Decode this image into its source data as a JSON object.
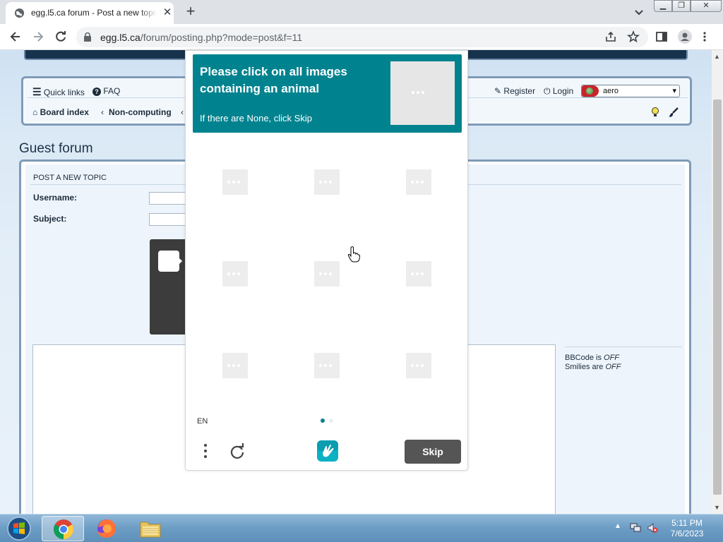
{
  "browser": {
    "tab_title": "egg.l5.ca forum - Post a new topic",
    "url_host": "egg.l5.ca",
    "url_path": "/forum/posting.php?mode=post&f=11"
  },
  "nav": {
    "quick_links": "Quick links",
    "faq": "FAQ",
    "register": "Register",
    "login": "Login",
    "board_index": "Board index",
    "crumb": "Non-computing",
    "style_value": "aero"
  },
  "page": {
    "forum_title": "Guest forum",
    "post_heading": "POST A NEW TOPIC",
    "username_label": "Username:",
    "subject_label": "Subject:",
    "bbcode_text": "BBCode is ",
    "bbcode_state": "OFF",
    "smilies_text": "Smilies are ",
    "smilies_state": "OFF"
  },
  "captcha": {
    "prompt": "Please click on all images containing an animal",
    "subprompt": "If there are None, click Skip",
    "language": "EN",
    "skip_label": "Skip",
    "tiles": 9,
    "page_count": 2,
    "current_page": 1,
    "accent_color": "#00838f"
  },
  "taskbar": {
    "time": "5:11 PM",
    "date": "7/6/2023"
  }
}
